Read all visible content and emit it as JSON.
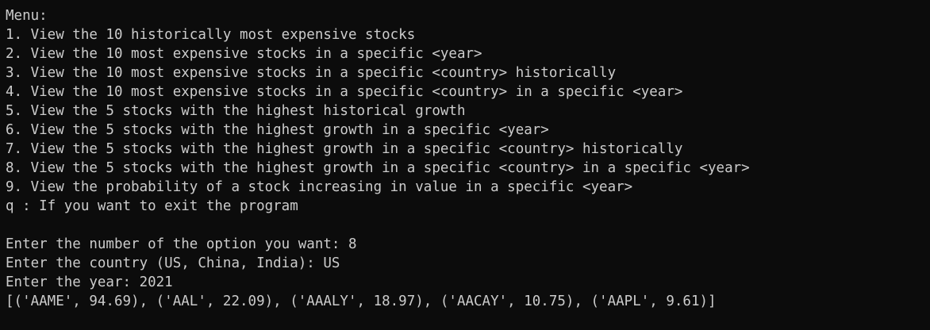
{
  "terminal": {
    "menu_header": "Menu:",
    "menu_items": [
      "1. View the 10 historically most expensive stocks",
      "2. View the 10 most expensive stocks in a specific <year>",
      "3. View the 10 most expensive stocks in a specific <country> historically",
      "4. View the 10 most expensive stocks in a specific <country> in a specific <year>",
      "5. View the 5 stocks with the highest historical growth",
      "6. View the 5 stocks with the highest growth in a specific <year>",
      "7. View the 5 stocks with the highest growth in a specific <country> historically",
      "8. View the 5 stocks with the highest growth in a specific <country> in a specific <year>",
      "9. View the probability of a stock increasing in value in a specific <year>",
      "q : If you want to exit the program"
    ],
    "prompts": [
      "Enter the number of the option you want: 8",
      "Enter the country (US, China, India): US",
      "Enter the year: 2021"
    ],
    "result": "[('AAME', 94.69), ('AAL', 22.09), ('AAALY', 18.97), ('AACAY', 10.75), ('AAPL', 9.61)]"
  }
}
